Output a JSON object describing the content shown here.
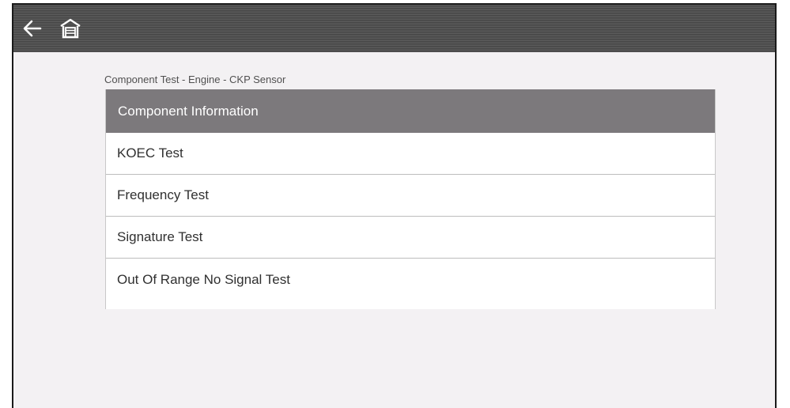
{
  "toolbar": {
    "back_icon": "arrow-left-icon",
    "home_icon": "garage-home-icon"
  },
  "breadcrumb": "Component Test - Engine - CKP Sensor",
  "menu": {
    "header": "Component Information",
    "items": [
      {
        "label": "KOEC Test"
      },
      {
        "label": "Frequency Test"
      },
      {
        "label": "Signature Test"
      },
      {
        "label": "Out Of Range No Signal Test"
      }
    ]
  },
  "colors": {
    "topbar": "#4e4e4e",
    "header_bg": "#7c797c",
    "page_bg": "#f3f1f3"
  }
}
